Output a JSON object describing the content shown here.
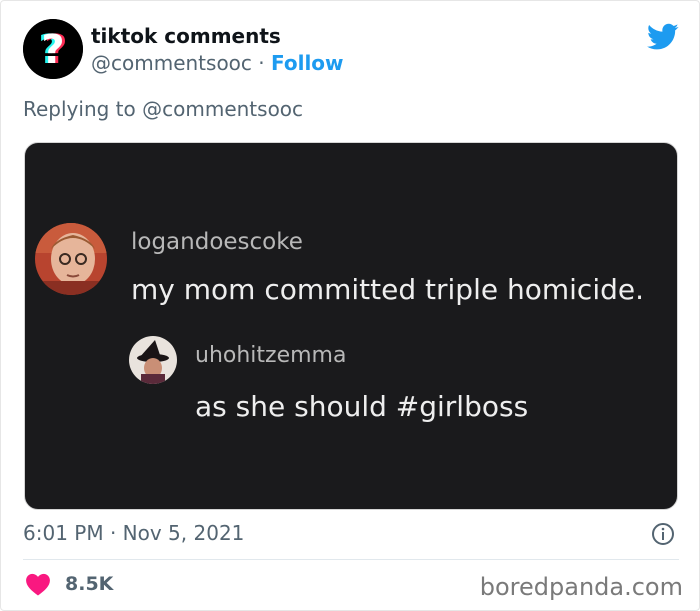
{
  "tweet": {
    "display_name": "tiktok comments",
    "handle": "@commentsooc",
    "separator": " · ",
    "follow_label": "Follow",
    "reply_prefix": "Replying to ",
    "reply_handle": "@commentsooc",
    "timestamp": "6:01 PM · Nov 5, 2021",
    "like_count": "8.5K"
  },
  "media": {
    "comment1": {
      "username": "logandoescoke",
      "text": "my mom committed triple homicide."
    },
    "comment2": {
      "username": "uhohitzemma",
      "text": "as she should #girlboss"
    }
  },
  "watermark": "boredpanda.com",
  "icons": {
    "twitter": "twitter-bird-icon",
    "info": "info-icon",
    "heart": "heart-icon",
    "avatar": "question-mark-logo"
  },
  "colors": {
    "twitter_blue": "#1d9bf0",
    "heart_pink": "#f91880",
    "muted_text": "#536471",
    "media_bg": "#1a1a1c"
  }
}
